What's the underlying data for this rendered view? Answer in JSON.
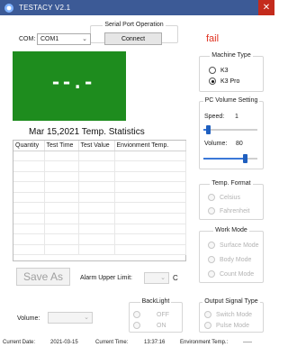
{
  "window": {
    "title": "TESTACY  V2.1",
    "close_glyph": "✕"
  },
  "serial": {
    "legend": "Serial Port Operation",
    "com_label": "COM:",
    "com_value": "COM1",
    "connect_label": "Connect",
    "status": "fail",
    "status_color": "#e0301e"
  },
  "display": {
    "reading": "--.-",
    "bg_color": "#1e8c1e"
  },
  "stats": {
    "title": "Mar 15,2021 Temp. Statistics",
    "columns": [
      "Quantity",
      "Test Time",
      "Test Value",
      "Envionment Temp."
    ],
    "rows": []
  },
  "machine_type": {
    "legend": "Machine Type",
    "options": [
      {
        "label": "K3",
        "checked": false
      },
      {
        "label": "K3 Pro",
        "checked": true
      }
    ]
  },
  "pc_volume": {
    "legend": "PC Volume Setting",
    "speed_label": "Speed:",
    "speed_value": "1",
    "speed_level": 0.05,
    "volume_label": "Volume:",
    "volume_value": "80",
    "volume_level": 0.8
  },
  "temp_format": {
    "legend": "Temp. Format",
    "options": [
      {
        "label": "Celsius",
        "checked": false
      },
      {
        "label": "Fahrenheit",
        "checked": false
      }
    ]
  },
  "work_mode": {
    "legend": "Work Mode",
    "options": [
      {
        "label": "Surface Mode",
        "checked": false
      },
      {
        "label": "Body Mode",
        "checked": false
      },
      {
        "label": "Count Mode",
        "checked": false
      }
    ]
  },
  "save_as_label": "Save As",
  "alarm": {
    "label": "Alarm Upper Limit:",
    "value": "",
    "unit": "C"
  },
  "backlight": {
    "legend": "BackLight",
    "options": [
      {
        "label": "OFF",
        "checked": false
      },
      {
        "label": "ON",
        "checked": false
      }
    ]
  },
  "output_signal": {
    "legend": "Output Signal Type",
    "options": [
      {
        "label": "Switch Mode",
        "checked": false
      },
      {
        "label": "Pulse Mode",
        "checked": false
      }
    ]
  },
  "bottom_volume": {
    "label": "Volume:",
    "value": ""
  },
  "statusbar": {
    "date_label": "Current Date:",
    "date_value": "2021-03-15",
    "time_label": "Current Time:",
    "time_value": "13:37:16",
    "env_label": "Environment Temp.:",
    "env_value": "-----"
  },
  "icons": {
    "app": "app-logo-icon",
    "dropdown": "chevron-down-icon"
  }
}
